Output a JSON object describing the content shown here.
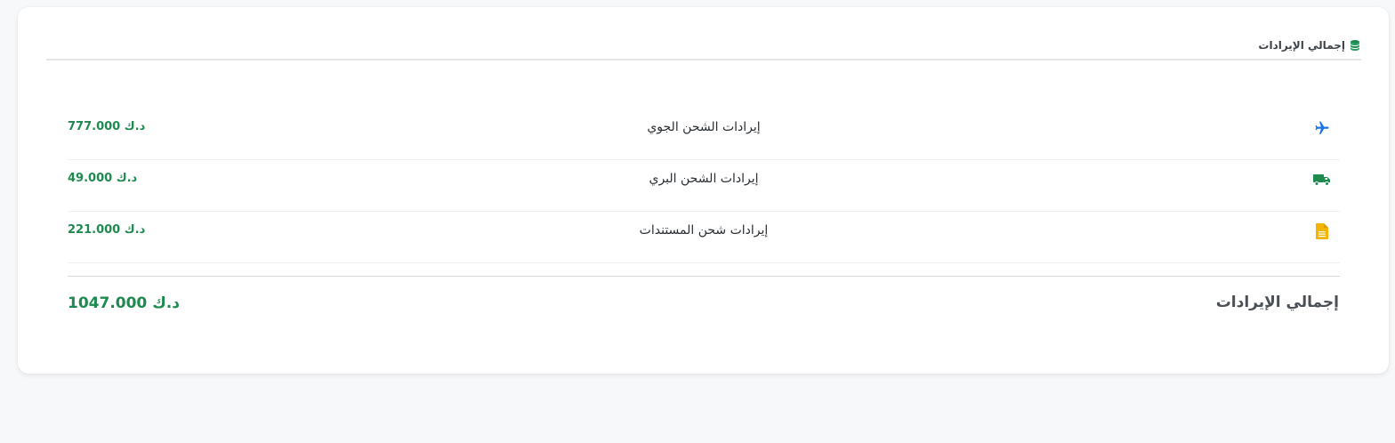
{
  "header": {
    "title": "إجمالي الإيرادات",
    "icon": "coins-icon"
  },
  "rows": [
    {
      "icon": "plane-icon",
      "icon_color": "#1a73e8",
      "label": "إيرادات الشحن الجوي",
      "value": "777.000 د.ك"
    },
    {
      "icon": "truck-icon",
      "icon_color": "#1e8a50",
      "label": "إيرادات الشحن البري",
      "value": "49.000 د.ك"
    },
    {
      "icon": "document-icon",
      "icon_color": "#f4b400",
      "label": "إيرادات شحن المستندات",
      "value": "221.000 د.ك"
    }
  ],
  "total": {
    "label": "إجمالي الإيرادات",
    "value": "1047.000 د.ك"
  },
  "colors": {
    "accent_green": "#1e8a50",
    "text_dark": "#2a2f33",
    "background": "#f7f8fa"
  }
}
